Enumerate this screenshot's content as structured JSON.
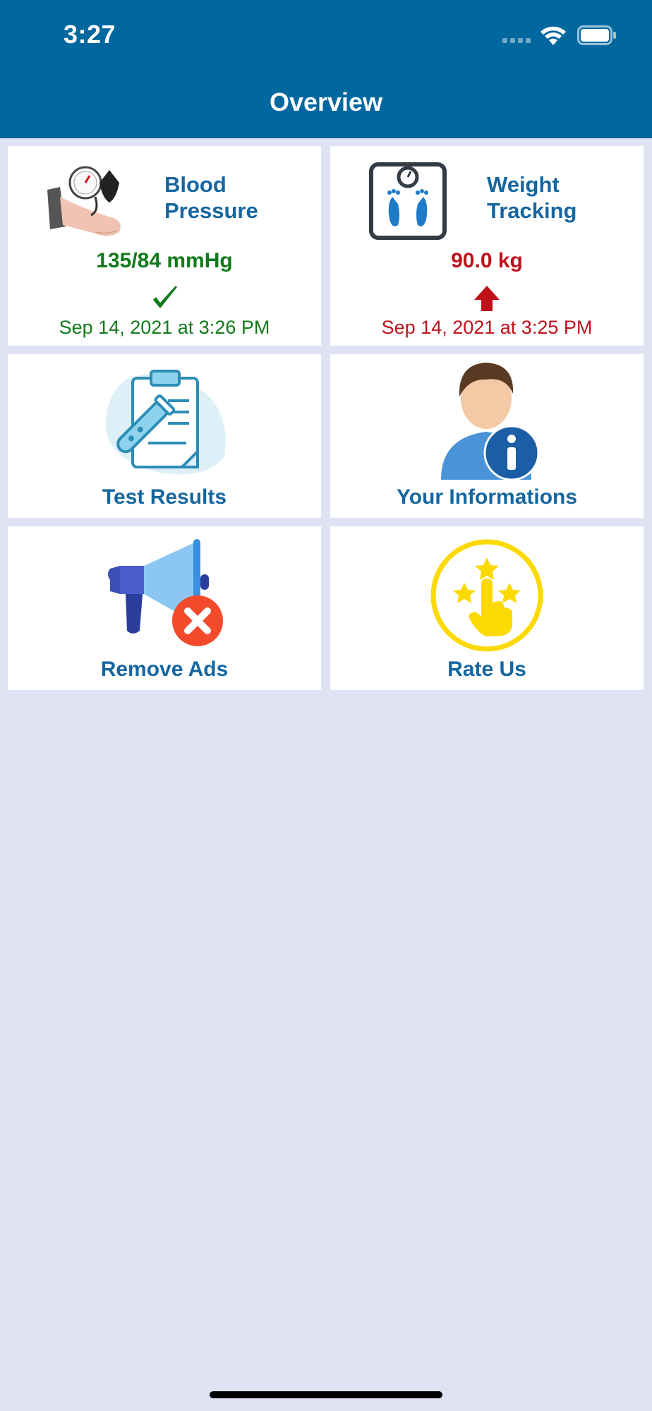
{
  "status_bar": {
    "time": "3:27"
  },
  "nav": {
    "title": "Overview"
  },
  "tiles": {
    "blood_pressure": {
      "title": "Blood Pressure",
      "value": "135/84 mmHg",
      "timestamp": "Sep 14, 2021 at 3:26 PM",
      "status_icon": "checkmark-icon",
      "color": "#117A1B"
    },
    "weight": {
      "title": "Weight Tracking",
      "value": "90.0 kg",
      "timestamp": "Sep 14, 2021 at 3:25 PM",
      "status_icon": "arrow-up-icon",
      "color": "#C0111A"
    },
    "test_results": {
      "label": "Test Results",
      "icon": "clipboard-test-tube-icon"
    },
    "your_informations": {
      "label": "Your Informations",
      "icon": "user-info-icon"
    },
    "remove_ads": {
      "label": "Remove Ads",
      "icon": "megaphone-cancel-icon"
    },
    "rate_us": {
      "label": "Rate Us",
      "icon": "hand-stars-icon"
    }
  },
  "colors": {
    "nav_bg": "#00679F",
    "page_bg": "#DFE2F3",
    "label_blue": "#1566A0"
  }
}
